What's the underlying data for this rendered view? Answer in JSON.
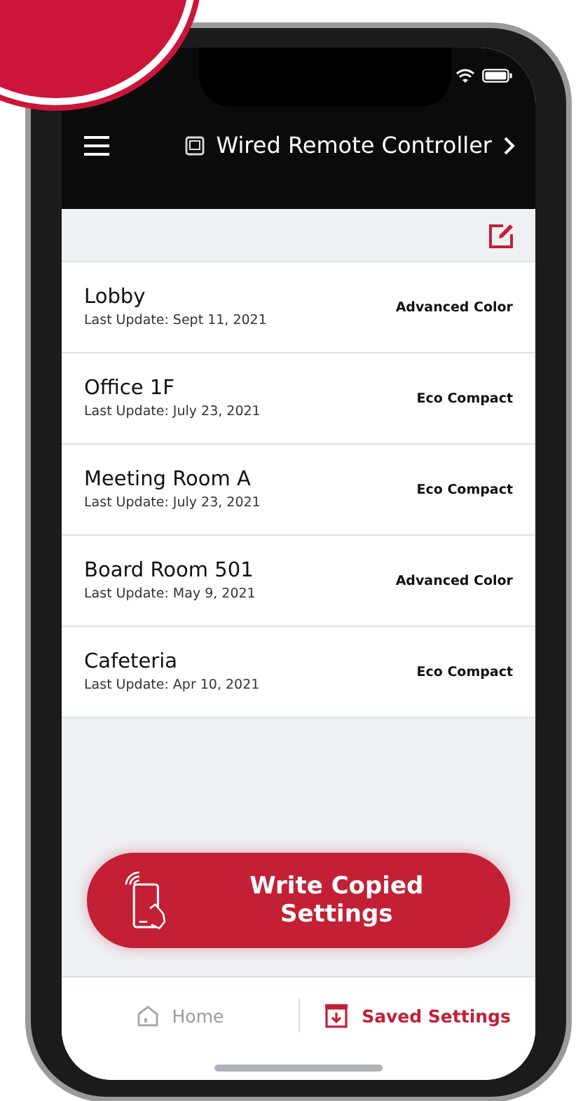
{
  "header": {
    "title": "Wired Remote Controller"
  },
  "devices": [
    {
      "name": "Lobby",
      "updated": "Last Update: Sept 11, 2021",
      "model": "Advanced Color"
    },
    {
      "name": "Office 1F",
      "updated": "Last Update: July 23, 2021",
      "model": "Eco Compact"
    },
    {
      "name": "Meeting Room A",
      "updated": "Last Update: July 23, 2021",
      "model": "Eco Compact"
    },
    {
      "name": "Board Room 501",
      "updated": "Last Update: May 9, 2021",
      "model": "Advanced Color"
    },
    {
      "name": "Cafeteria",
      "updated": "Last Update: Apr 10, 2021",
      "model": "Eco Compact"
    }
  ],
  "action_button": {
    "label": "Write Copied Settings"
  },
  "tabs": [
    {
      "label": "Home",
      "selected": false,
      "kind": "home"
    },
    {
      "label": "Saved Settings",
      "selected": true,
      "kind": "saved"
    }
  ]
}
